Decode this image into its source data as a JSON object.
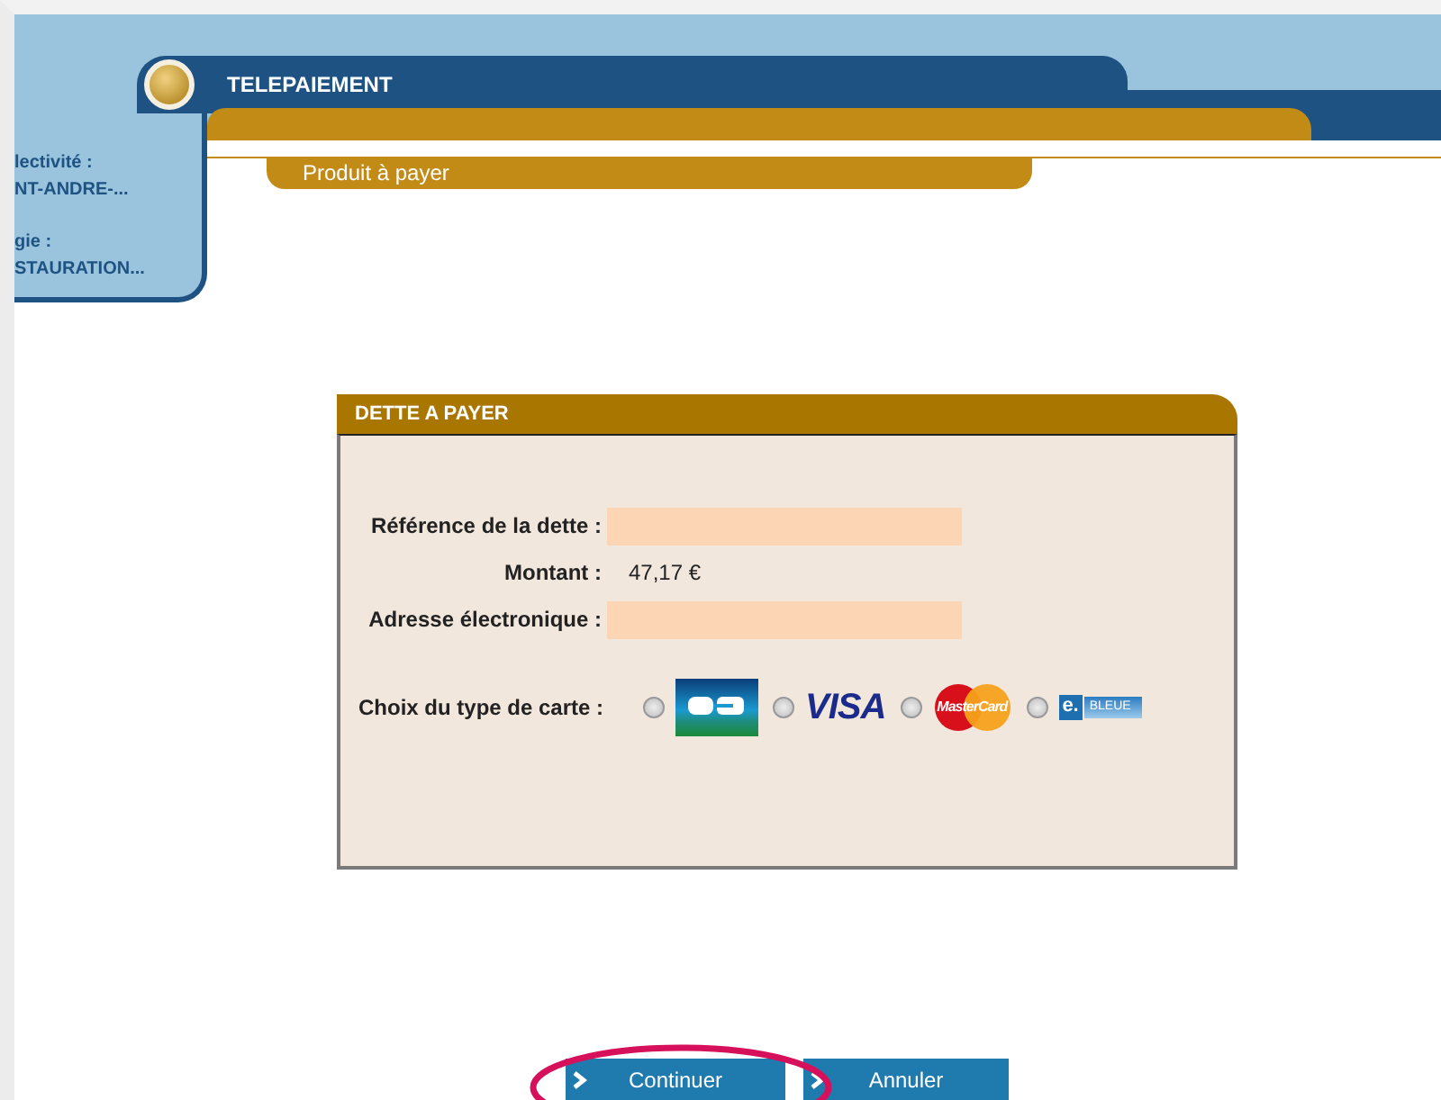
{
  "header": {
    "title": "TELEPAIEMENT",
    "subtitle": "Produit à payer"
  },
  "sidebar": {
    "items": [
      {
        "label": "lectivité :",
        "value": "NT-ANDRE-..."
      },
      {
        "label": "gie :",
        "value": "STAURATION..."
      }
    ]
  },
  "panel": {
    "title": "DETTE A PAYER",
    "fields": [
      {
        "kind": "input",
        "label": "Référence de la dette :"
      },
      {
        "kind": "text",
        "label": "Montant :",
        "value": "47,17 €"
      },
      {
        "kind": "input",
        "label": "Adresse électronique :"
      }
    ],
    "card_choice": {
      "label": "Choix du type de carte :",
      "cards": [
        {
          "kind": "cb",
          "selected": false
        },
        {
          "kind": "visa",
          "text": "VISA",
          "selected": false
        },
        {
          "kind": "mastercard",
          "text": "MasterCard",
          "selected": false
        },
        {
          "kind": "ebleue",
          "text": "e.",
          "text_2": "BLEUE",
          "selected": false
        }
      ]
    }
  },
  "buttons": [
    {
      "label": "Continuer",
      "highlighted": true
    },
    {
      "label": "Annuler",
      "highlighted": false
    }
  ]
}
